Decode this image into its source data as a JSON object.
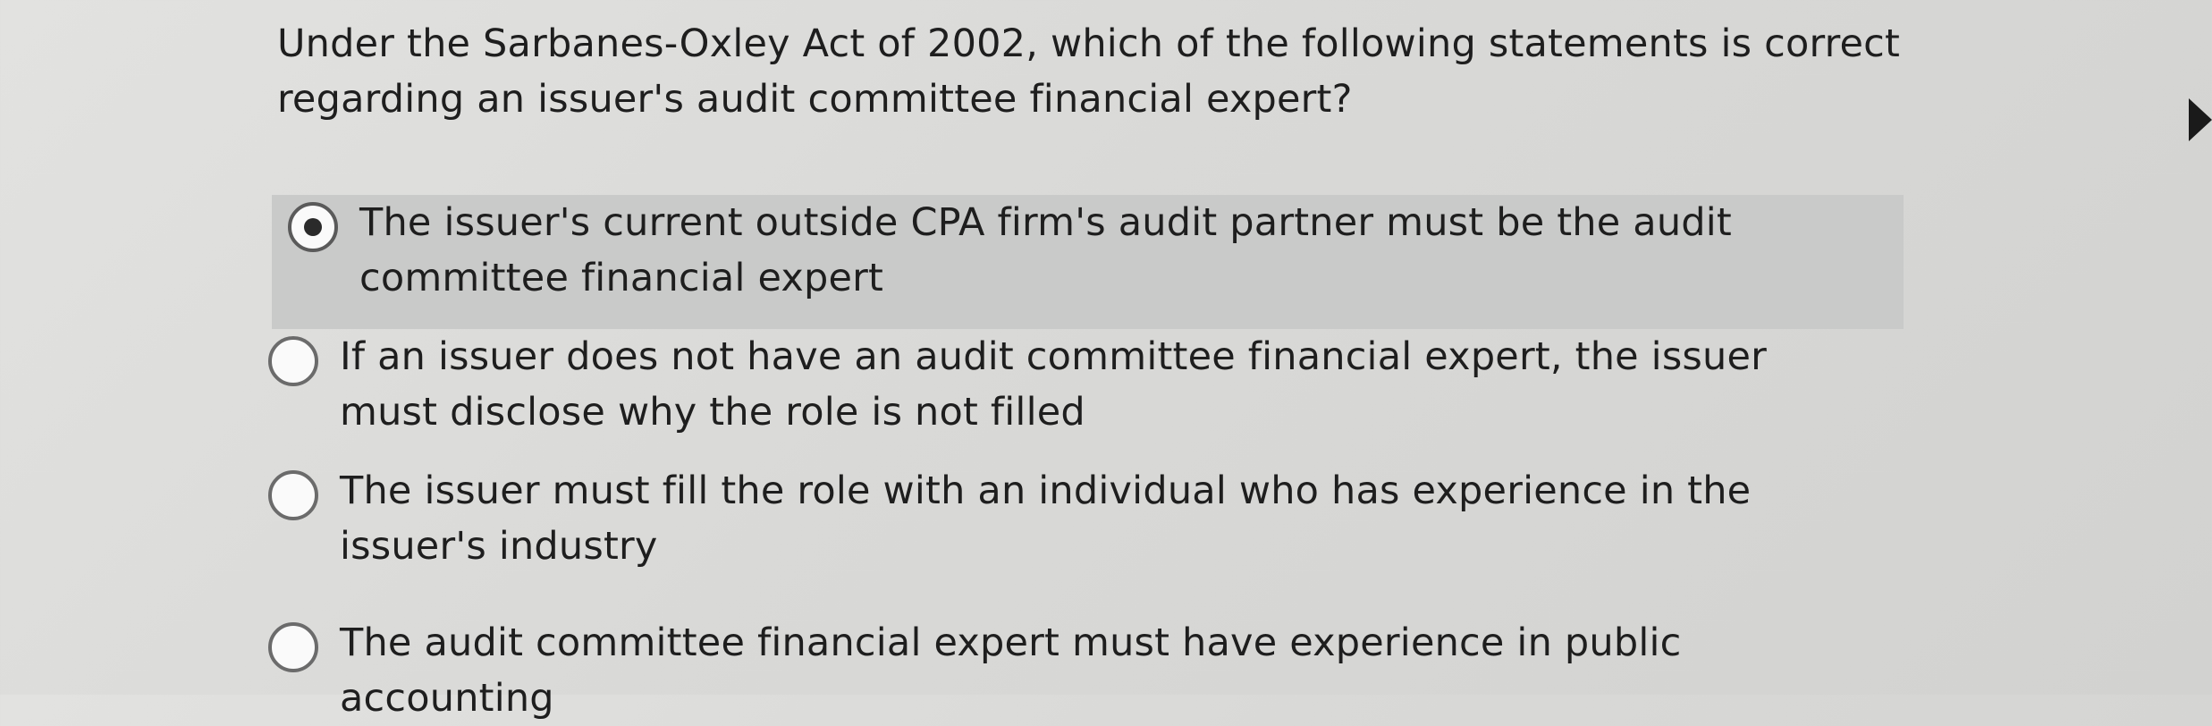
{
  "question": {
    "text": "Under the Sarbanes-Oxley Act of 2002, which of the following statements is correct regarding an issuer's audit committee financial expert?"
  },
  "options": [
    {
      "label": "The issuer's current outside CPA firm's audit partner must be the audit committee financial expert",
      "selected": true
    },
    {
      "label": "If an issuer does not have an audit committee financial expert, the issuer must disclose why the role is not filled",
      "selected": false
    },
    {
      "label": "The issuer must fill the role with an individual who has experience in the issuer's industry",
      "selected": false
    },
    {
      "label": "The audit committee financial expert must have experience in public accounting",
      "selected": false
    }
  ],
  "icons": {
    "radio_selected": "radio-selected-icon",
    "radio_unselected": "radio-unselected-icon",
    "cursor": "mouse-cursor-icon"
  },
  "colors": {
    "selected_highlight": "#c9cac9",
    "background": "#dcdcda",
    "text": "#1e1e1e"
  }
}
